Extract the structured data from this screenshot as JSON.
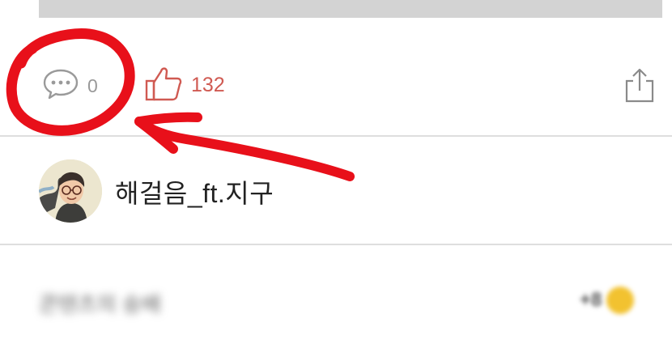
{
  "actions": {
    "comment_count": "0",
    "like_count": "132"
  },
  "author": {
    "name": "해걸음_ft.지구"
  },
  "blurred_row": {
    "left_text": "콘텐츠의 숭배",
    "right_text": "+8"
  },
  "colors": {
    "like_accent": "#d05a52",
    "annotation_red": "#e8101a",
    "divider": "#dedede",
    "top_bar": "#d3d3d3"
  },
  "icons": {
    "comment": "speech-bubble-dots-icon",
    "like": "thumbs-up-icon",
    "share": "share-upload-icon",
    "coin": "gold-coin-icon"
  }
}
